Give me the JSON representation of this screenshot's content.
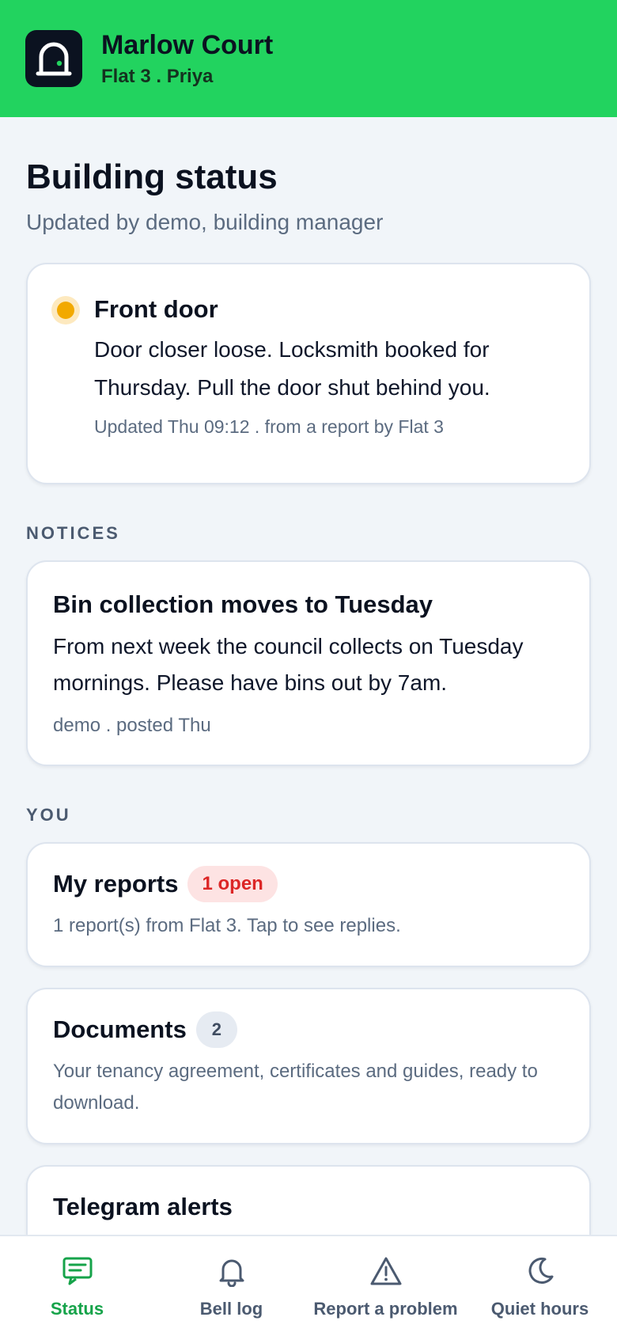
{
  "header": {
    "title": "Marlow Court",
    "subtitle": "Flat 3 . Priya"
  },
  "page": {
    "title": "Building status",
    "subtitle": "Updated by demo, building manager"
  },
  "status_card": {
    "title": "Front door",
    "text": "Door closer loose. Locksmith booked for Thursday. Pull the door shut behind you.",
    "meta": "Updated Thu 09:12 . from a report by Flat 3",
    "status_color": "#f2a900"
  },
  "notices": {
    "label": "NOTICES",
    "items": [
      {
        "title": "Bin collection moves to Tuesday",
        "text": "From next week the council collects on Tuesday mornings. Please have bins out by 7am.",
        "meta": "demo . posted Thu"
      }
    ]
  },
  "you": {
    "label": "YOU",
    "reports": {
      "title": "My reports",
      "badge": "1 open",
      "text": "1 report(s) from Flat 3. Tap to see replies."
    },
    "documents": {
      "title": "Documents",
      "badge": "2",
      "text": "Your tenancy agreement, certificates and guides, ready to download."
    },
    "telegram": {
      "title": "Telegram alerts"
    }
  },
  "nav": {
    "items": [
      {
        "label": "Status",
        "icon": "message-square-icon",
        "active": true
      },
      {
        "label": "Bell log",
        "icon": "bell-icon",
        "active": false
      },
      {
        "label": "Report a problem",
        "icon": "warning-triangle-icon",
        "active": false
      },
      {
        "label": "Quiet hours",
        "icon": "moon-icon",
        "active": false
      }
    ],
    "active_color": "#16a34a"
  },
  "colors": {
    "header_bg": "#22d35f",
    "page_bg": "#f1f5f9",
    "danger": "#dc2626"
  }
}
